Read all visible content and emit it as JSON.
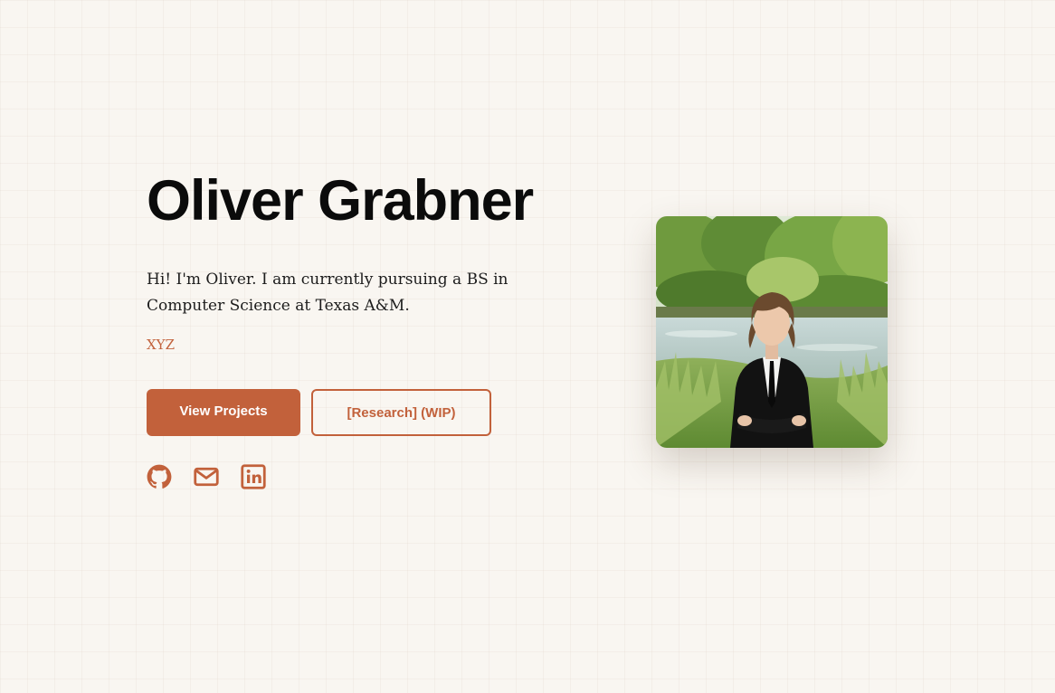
{
  "hero": {
    "name": "Oliver Grabner",
    "intro": "Hi! I'm Oliver. I am currently pursuing a BS in Computer Science at Texas A&M.",
    "tagline": "XYZ"
  },
  "buttons": {
    "primary_label": "View Projects",
    "secondary_label": "[Research] (WIP)"
  },
  "socials": [
    {
      "icon": "github-icon"
    },
    {
      "icon": "envelope-icon"
    },
    {
      "icon": "linkedin-icon"
    }
  ],
  "colors": {
    "accent": "#c2613b",
    "background": "#f9f6f1",
    "heading": "#0b0b0b"
  }
}
